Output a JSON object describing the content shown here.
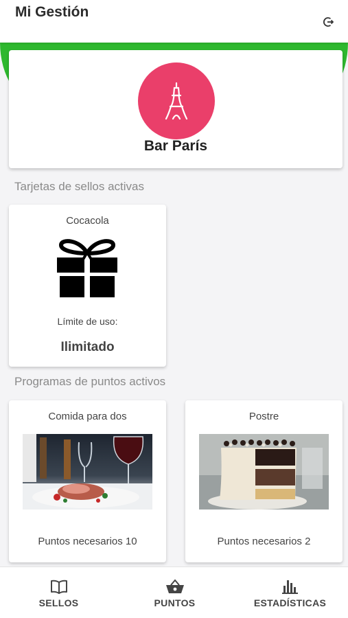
{
  "app": {
    "title": "Mi Gestión",
    "logout_icon": "logout-icon"
  },
  "business": {
    "name": "Bar París",
    "logo_color": "#ea3f6a",
    "logo_icon": "eiffel-tower-icon"
  },
  "accent_color": "#2eb82e",
  "stamp_section": {
    "title": "Tarjetas de sellos activas",
    "cards": [
      {
        "name": "Cocacola",
        "icon": "gift-icon",
        "limit_label": "Límite de uso:",
        "limit_value": "Ilimitado"
      }
    ]
  },
  "points_section": {
    "title": "Programas de puntos activos",
    "cards": [
      {
        "name": "Comida para dos",
        "points_text": "Puntos necesarios 10",
        "image": "steak-dinner-photo"
      },
      {
        "name": "Postre",
        "points_text": "Puntos necesarios 2",
        "image": "layer-cake-photo"
      }
    ]
  },
  "bottom_nav": {
    "items": [
      {
        "label": "SELLOS",
        "icon": "book-icon"
      },
      {
        "label": "PUNTOS",
        "icon": "basket-icon"
      },
      {
        "label": "ESTADÍSTICAS",
        "icon": "bar-chart-icon"
      }
    ]
  }
}
